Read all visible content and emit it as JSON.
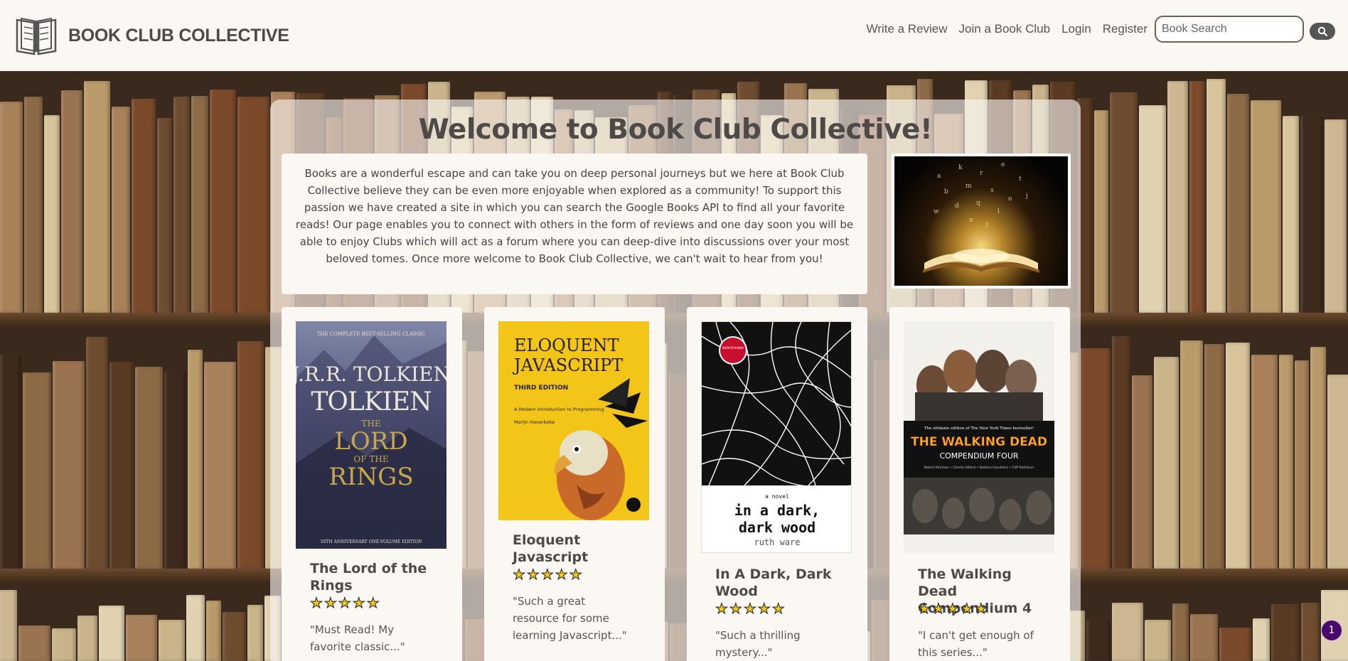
{
  "brand": {
    "name": "BOOK CLUB COLLECTIVE",
    "logo_icon": "open-book-icon"
  },
  "nav": {
    "links": [
      "Write a Review",
      "Join a Book Club",
      "Login",
      "Register"
    ],
    "search_placeholder": "Book Search",
    "search_icon": "search-icon"
  },
  "main": {
    "title": "Welcome to Book Club Collective!",
    "intro": "Books are a wonderful escape and can take you on deep personal journeys but we here at Book Club Collective believe they can be even more enjoyable when explored as a community! To support this passion we have created a site in which you can search the Google Books API to find all your favorite reads! Our page enables you to connect with others in the form of reviews and one day soon you will be able to enjoy Clubs which will act as a forum where you can deep-dive into discussions over your most beloved tomes. Once more welcome to Book Club Collective, we can't wait to hear from you!"
  },
  "books": [
    {
      "title": "The Lord of the Rings",
      "rating": 5,
      "stars": "★★★★★",
      "quote": "\"Must Read! My favorite classic...\"",
      "cover": {
        "top_line": "THE COMPLETE BEST-SELLING CLASSIC",
        "author": "J.R.R. TOLKIEN",
        "title_a": "THE",
        "title_b": "LORD",
        "title_c": "OF THE",
        "title_d": "RINGS",
        "bottom": "50TH ANNIVERSARY ONE-VOLUME EDITION"
      }
    },
    {
      "title": "Eloquent Javascript",
      "rating": 5,
      "stars": "★★★★★",
      "quote": "\"Such a great resource for some learning Javascript...\"",
      "cover": {
        "title_a": "ELOQUENT",
        "title_b": "JAVASCRIPT",
        "edition": "THIRD EDITION",
        "subtitle": "A Modern Introduction to Programming",
        "author": "Marijn Haverbeke"
      }
    },
    {
      "title": "In A Dark, Dark Wood",
      "rating": 5,
      "stars": "★★★★★",
      "quote": "\"Such a thrilling mystery...\"",
      "cover": {
        "badge": "Instant New York Times Bestseller",
        "novel": "a novel",
        "title_a": "in a dark,",
        "title_b": "dark wood",
        "author": "ruth ware"
      }
    },
    {
      "title": "The Walking Dead Compendium 4",
      "rating": 5,
      "stars": "★★★★★",
      "quote": "\"I can't get enough of this series...\"",
      "cover": {
        "top": "The ultimate edition of The New York Times bestseller!",
        "title_a": "THE WALKING DEAD",
        "title_b": "COMPENDIUM FOUR",
        "credits": "Robert Kirkman • Charlie Adlard • Stefano Gaudiano • Cliff Rathburn"
      }
    }
  ],
  "notification_count": "1",
  "colors": {
    "nav_bg": "#fbf8f4",
    "text": "#4e4a47",
    "star": "#f5c518",
    "badge": "#4b0a6b"
  }
}
